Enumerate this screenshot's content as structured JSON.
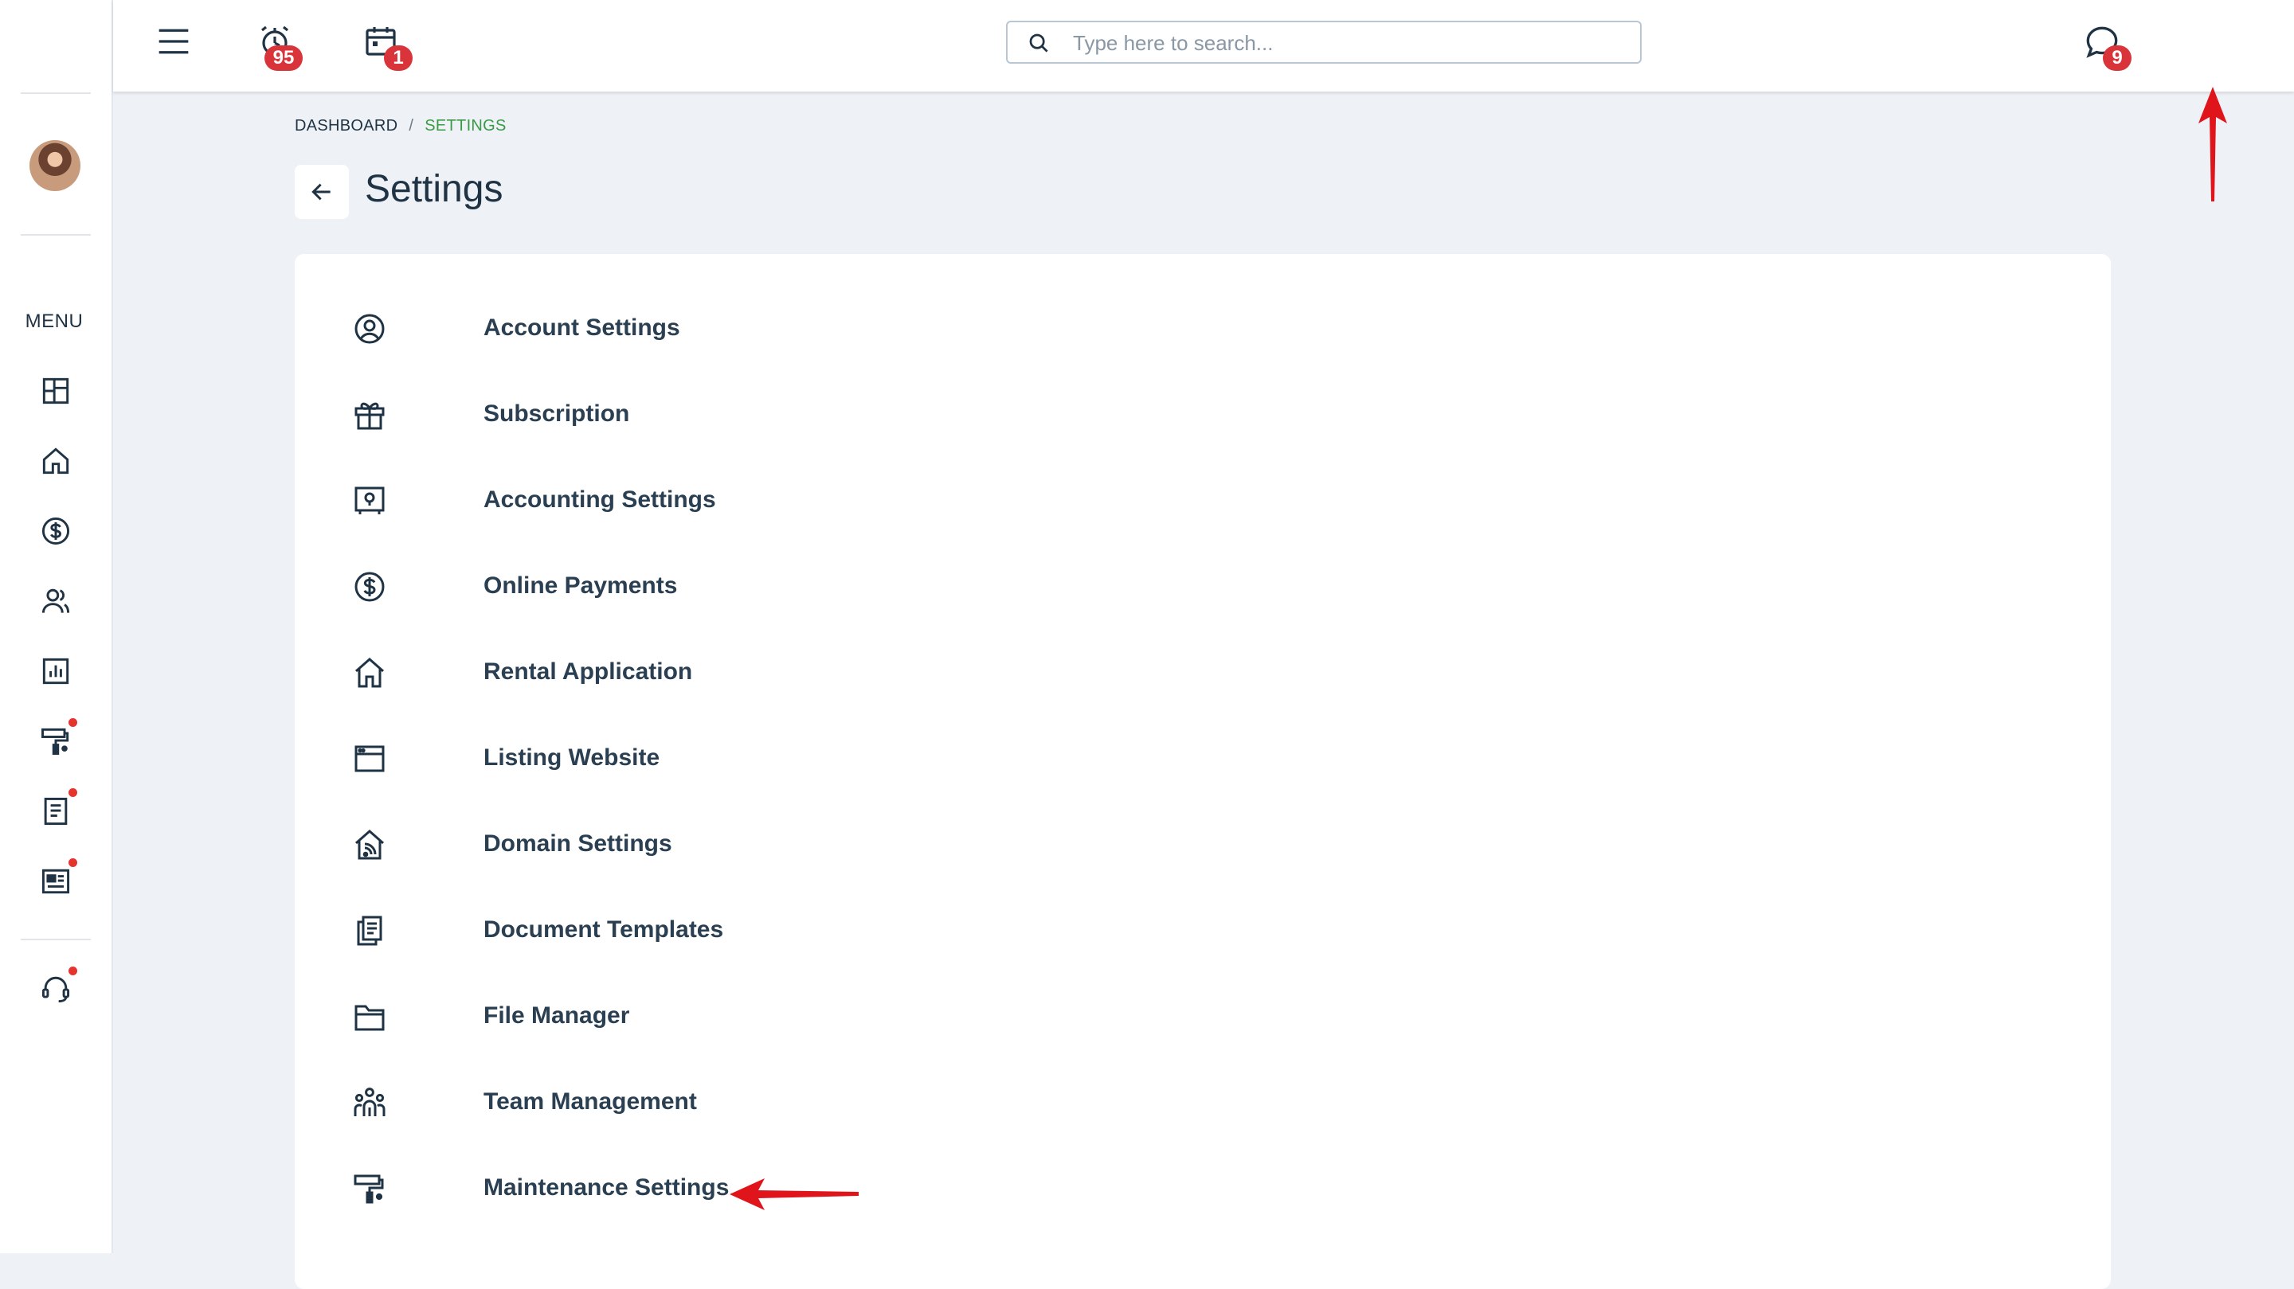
{
  "sidebar": {
    "menu_label": "MENU",
    "icons": [
      "dashboard-grid-icon",
      "home-icon",
      "dollar-icon",
      "people-icon",
      "report-chart-icon",
      "paint-roller-icon",
      "document-icon",
      "news-icon",
      "support-headset-icon"
    ]
  },
  "topbar": {
    "alerts_badge": "95",
    "calendar_badge": "1",
    "messages_badge": "9",
    "search_placeholder": "Type here to search...",
    "settings_icon_color": "#3a9b47"
  },
  "breadcrumb": {
    "root": "DASHBOARD",
    "separator": "/",
    "current": "SETTINGS"
  },
  "page": {
    "title": "Settings"
  },
  "settings_items": [
    {
      "label": "Account Settings",
      "icon": "user-circle-icon"
    },
    {
      "label": "Subscription",
      "icon": "gift-icon"
    },
    {
      "label": "Accounting Settings",
      "icon": "safe-icon"
    },
    {
      "label": "Online Payments",
      "icon": "dollar-circle-icon"
    },
    {
      "label": "Rental Application",
      "icon": "home-icon"
    },
    {
      "label": "Listing Website",
      "icon": "browser-window-icon"
    },
    {
      "label": "Domain Settings",
      "icon": "home-wifi-icon"
    },
    {
      "label": "Document Templates",
      "icon": "documents-icon"
    },
    {
      "label": "File Manager",
      "icon": "folder-icon"
    },
    {
      "label": "Team Management",
      "icon": "team-icon"
    },
    {
      "label": "Maintenance Settings",
      "icon": "paint-roller-icon"
    }
  ],
  "colors": {
    "accent_green": "#3a9b47",
    "badge_red": "#d9343a",
    "annotation_red": "#e0141b"
  }
}
